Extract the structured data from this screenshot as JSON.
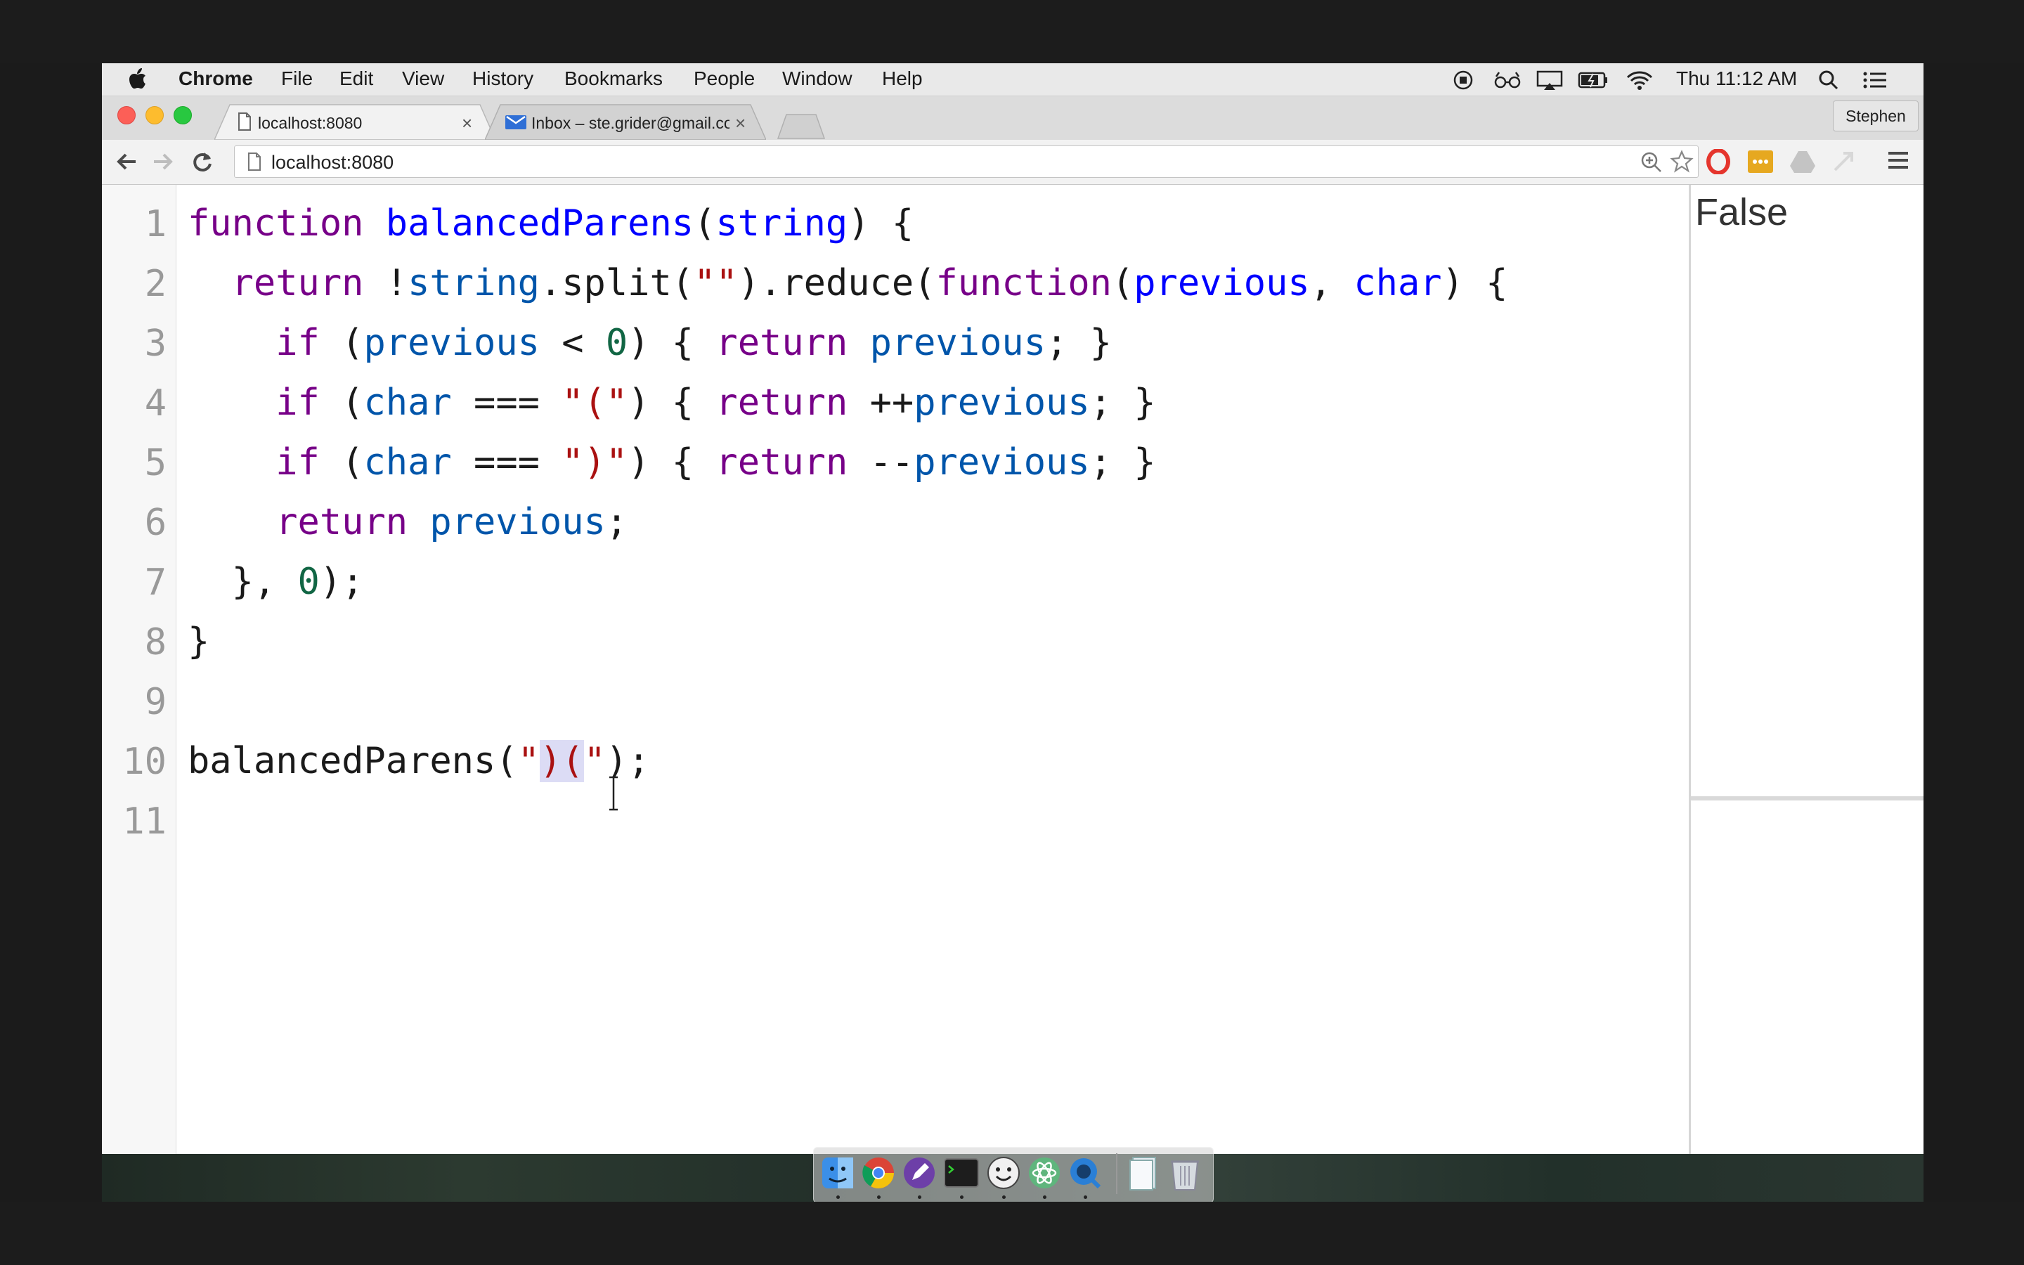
{
  "menubar": {
    "app": "Chrome",
    "items": [
      "File",
      "Edit",
      "View",
      "History",
      "Bookmarks",
      "People",
      "Window",
      "Help"
    ],
    "clock": "Thu 11:12 AM"
  },
  "tabs": [
    {
      "label": "localhost:8080",
      "icon": "page-icon",
      "active": true
    },
    {
      "label": "Inbox – ste.grider@gmail.co",
      "icon": "inbox-icon",
      "active": false
    }
  ],
  "profile": "Stephen",
  "address": {
    "url": "localhost:8080"
  },
  "editor": {
    "line_numbers": [
      "1",
      "2",
      "3",
      "4",
      "5",
      "6",
      "7",
      "8",
      "9",
      "10",
      "11"
    ]
  },
  "output": {
    "result": "False"
  },
  "colors": {
    "keyword": "#770088",
    "definition": "#0000ff",
    "variable": "#0055aa",
    "number": "#116644",
    "string": "#aa1111",
    "selection": "#dcdcf5"
  }
}
